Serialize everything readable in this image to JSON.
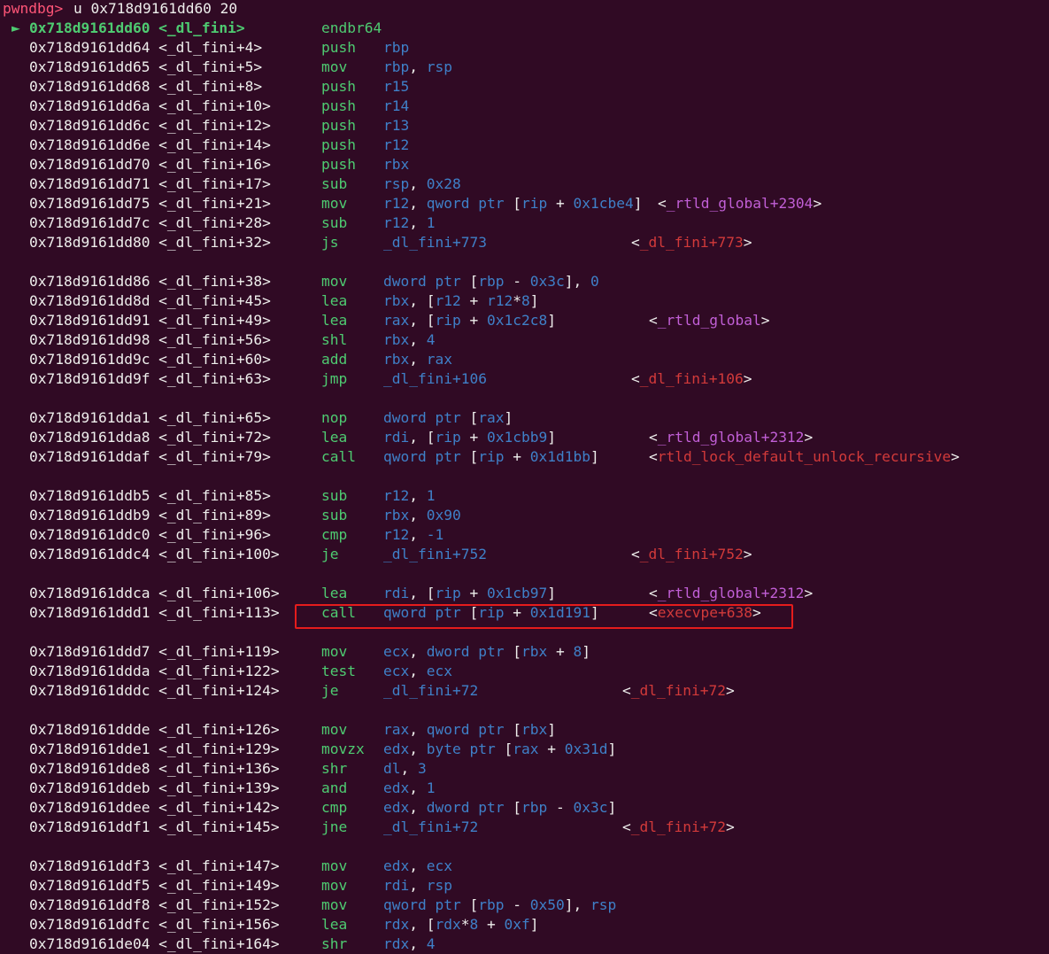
{
  "terminal": {
    "prompt": "pwndbg>",
    "command": "u 0x718d9161dd60 20",
    "cursor_marker": "►",
    "highlight_color": "#e51c1c"
  },
  "disasm": [
    {
      "addr": "0x718d9161dd60 <_dl_fini>",
      "mn": "endbr64",
      "ops": "",
      "current": true
    },
    {
      "addr": "0x718d9161dd64 <_dl_fini+4>",
      "mn": "push",
      "ops": "rbp"
    },
    {
      "addr": "0x718d9161dd65 <_dl_fini+5>",
      "mn": "mov",
      "ops": "rbp, rsp"
    },
    {
      "addr": "0x718d9161dd68 <_dl_fini+8>",
      "mn": "push",
      "ops": "r15"
    },
    {
      "addr": "0x718d9161dd6a <_dl_fini+10>",
      "mn": "push",
      "ops": "r14"
    },
    {
      "addr": "0x718d9161dd6c <_dl_fini+12>",
      "mn": "push",
      "ops": "r13"
    },
    {
      "addr": "0x718d9161dd6e <_dl_fini+14>",
      "mn": "push",
      "ops": "r12"
    },
    {
      "addr": "0x718d9161dd70 <_dl_fini+16>",
      "mn": "push",
      "ops": "rbx"
    },
    {
      "addr": "0x718d9161dd71 <_dl_fini+17>",
      "mn": "sub",
      "ops": "rsp, 0x28"
    },
    {
      "addr": "0x718d9161dd75 <_dl_fini+21>",
      "mn": "mov",
      "ops": "r12, qword ptr [rip + 0x1cbe4]",
      "cmt": "_rtld_global+2304",
      "cmt_color": "g"
    },
    {
      "addr": "0x718d9161dd7c <_dl_fini+28>",
      "mn": "sub",
      "ops": "r12, 1"
    },
    {
      "addr": "0x718d9161dd80 <_dl_fini+32>",
      "mn": "js",
      "ops": "_dl_fini+773",
      "cmt": "_dl_fini+773",
      "cmt_color": "r"
    },
    null,
    {
      "addr": "0x718d9161dd86 <_dl_fini+38>",
      "mn": "mov",
      "ops": "dword ptr [rbp - 0x3c], 0"
    },
    {
      "addr": "0x718d9161dd8d <_dl_fini+45>",
      "mn": "lea",
      "ops": "rbx, [r12 + r12*8]"
    },
    {
      "addr": "0x718d9161dd91 <_dl_fini+49>",
      "mn": "lea",
      "ops": "rax, [rip + 0x1c2c8]",
      "cmt": "_rtld_global",
      "cmt_color": "g"
    },
    {
      "addr": "0x718d9161dd98 <_dl_fini+56>",
      "mn": "shl",
      "ops": "rbx, 4"
    },
    {
      "addr": "0x718d9161dd9c <_dl_fini+60>",
      "mn": "add",
      "ops": "rbx, rax"
    },
    {
      "addr": "0x718d9161dd9f <_dl_fini+63>",
      "mn": "jmp",
      "ops": "_dl_fini+106",
      "cmt": "_dl_fini+106",
      "cmt_color": "r"
    },
    null,
    {
      "addr": "0x718d9161dda1 <_dl_fini+65>",
      "mn": "nop",
      "ops": "dword ptr [rax]"
    },
    {
      "addr": "0x718d9161dda8 <_dl_fini+72>",
      "mn": "lea",
      "ops": "rdi, [rip + 0x1cbb9]",
      "cmt": "_rtld_global+2312",
      "cmt_color": "g"
    },
    {
      "addr": "0x718d9161ddaf <_dl_fini+79>",
      "mn": "call",
      "ops": "qword ptr [rip + 0x1d1bb]",
      "cmt": "rtld_lock_default_unlock_recursive",
      "cmt_color": "r"
    },
    null,
    {
      "addr": "0x718d9161ddb5 <_dl_fini+85>",
      "mn": "sub",
      "ops": "r12, 1"
    },
    {
      "addr": "0x718d9161ddb9 <_dl_fini+89>",
      "mn": "sub",
      "ops": "rbx, 0x90"
    },
    {
      "addr": "0x718d9161ddc0 <_dl_fini+96>",
      "mn": "cmp",
      "ops": "r12, -1"
    },
    {
      "addr": "0x718d9161ddc4 <_dl_fini+100>",
      "mn": "je",
      "ops": "_dl_fini+752",
      "cmt": "_dl_fini+752",
      "cmt_color": "r"
    },
    null,
    {
      "addr": "0x718d9161ddca <_dl_fini+106>",
      "mn": "lea",
      "ops": "rdi, [rip + 0x1cb97]",
      "cmt": "_rtld_global+2312",
      "cmt_color": "g"
    },
    {
      "addr": "0x718d9161ddd1 <_dl_fini+113>",
      "mn": "call",
      "ops": "qword ptr [rip + 0x1d191]",
      "cmt": "execvpe+638",
      "cmt_color": "r",
      "highlighted": true
    },
    null,
    {
      "addr": "0x718d9161ddd7 <_dl_fini+119>",
      "mn": "mov",
      "ops": "ecx, dword ptr [rbx + 8]"
    },
    {
      "addr": "0x718d9161ddda <_dl_fini+122>",
      "mn": "test",
      "ops": "ecx, ecx"
    },
    {
      "addr": "0x718d9161dddc <_dl_fini+124>",
      "mn": "je",
      "ops": "_dl_fini+72",
      "cmt": "_dl_fini+72",
      "cmt_color": "r"
    },
    null,
    {
      "addr": "0x718d9161ddde <_dl_fini+126>",
      "mn": "mov",
      "ops": "rax, qword ptr [rbx]"
    },
    {
      "addr": "0x718d9161dde1 <_dl_fini+129>",
      "mn": "movzx",
      "ops": "edx, byte ptr [rax + 0x31d]"
    },
    {
      "addr": "0x718d9161dde8 <_dl_fini+136>",
      "mn": "shr",
      "ops": "dl, 3"
    },
    {
      "addr": "0x718d9161ddeb <_dl_fini+139>",
      "mn": "and",
      "ops": "edx, 1"
    },
    {
      "addr": "0x718d9161ddee <_dl_fini+142>",
      "mn": "cmp",
      "ops": "edx, dword ptr [rbp - 0x3c]"
    },
    {
      "addr": "0x718d9161ddf1 <_dl_fini+145>",
      "mn": "jne",
      "ops": "_dl_fini+72",
      "cmt": "_dl_fini+72",
      "cmt_color": "r"
    },
    null,
    {
      "addr": "0x718d9161ddf3 <_dl_fini+147>",
      "mn": "mov",
      "ops": "edx, ecx"
    },
    {
      "addr": "0x718d9161ddf5 <_dl_fini+149>",
      "mn": "mov",
      "ops": "rdi, rsp"
    },
    {
      "addr": "0x718d9161ddf8 <_dl_fini+152>",
      "mn": "mov",
      "ops": "qword ptr [rbp - 0x50], rsp"
    },
    {
      "addr": "0x718d9161ddfc <_dl_fini+156>",
      "mn": "lea",
      "ops": "rdx, [rdx*8 + 0xf]"
    },
    {
      "addr": "0x718d9161de04 <_dl_fini+164>",
      "mn": "shr",
      "ops": "rdx, 4"
    }
  ]
}
